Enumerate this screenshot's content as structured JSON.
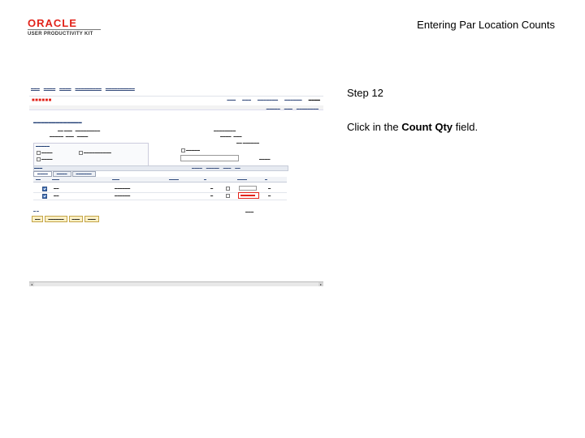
{
  "header": {
    "logo_word": "ORACLE",
    "logo_sub": "USER PRODUCTIVITY KIT",
    "doc_title": "Entering Par Location Counts"
  },
  "step": {
    "label": "Step 12",
    "instruction_prefix": "Click in the ",
    "instruction_bold": "Count Qty",
    "instruction_suffix": " field."
  },
  "colors": {
    "oracle_red": "#e2231a",
    "link_blue": "#334a7a"
  }
}
